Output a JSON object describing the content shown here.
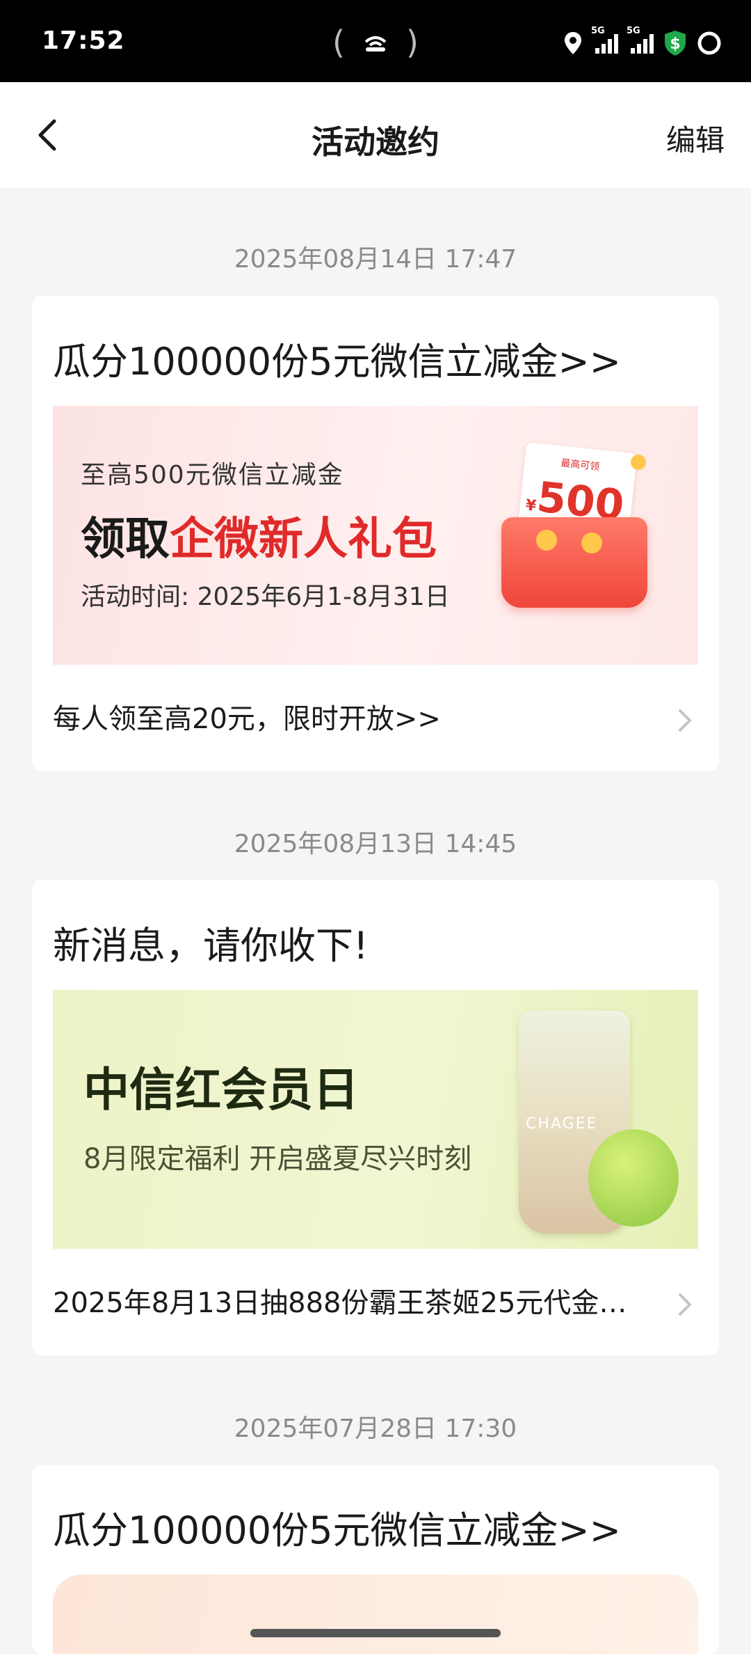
{
  "status": {
    "time": "17:52",
    "network_label": "5G"
  },
  "nav": {
    "title": "活动邀约",
    "edit_label": "编辑"
  },
  "messages": [
    {
      "date": "2025年08月14日 17:47",
      "title": "瓜分100000份5元微信立减金>>",
      "banner": {
        "line1": "至高500元微信立减金",
        "headline_dark": "领取",
        "headline_red": "企微新人礼包",
        "period": "活动时间: 2025年6月1-8月31日",
        "ticket_tag": "最高可领",
        "ticket_amount": "500",
        "ticket_currency": "¥"
      },
      "footer": "每人领至高20元，限时开放>>"
    },
    {
      "date": "2025年08月13日 14:45",
      "title": "新消息，请你收下!",
      "banner": {
        "headline": "中信红会员日",
        "subline": "8月限定福利 开启盛夏尽兴时刻",
        "cup_brand": "CHAGEE"
      },
      "footer": "2025年8月13日抽888份霸王茶姬25元代金…"
    },
    {
      "date": "2025年07月28日 17:30",
      "title": "瓜分100000份5元微信立减金>>"
    }
  ],
  "colors": {
    "accent_red": "#e02a2a",
    "text_dark": "#1a1a1a",
    "date_gray": "#8a8a8a"
  }
}
